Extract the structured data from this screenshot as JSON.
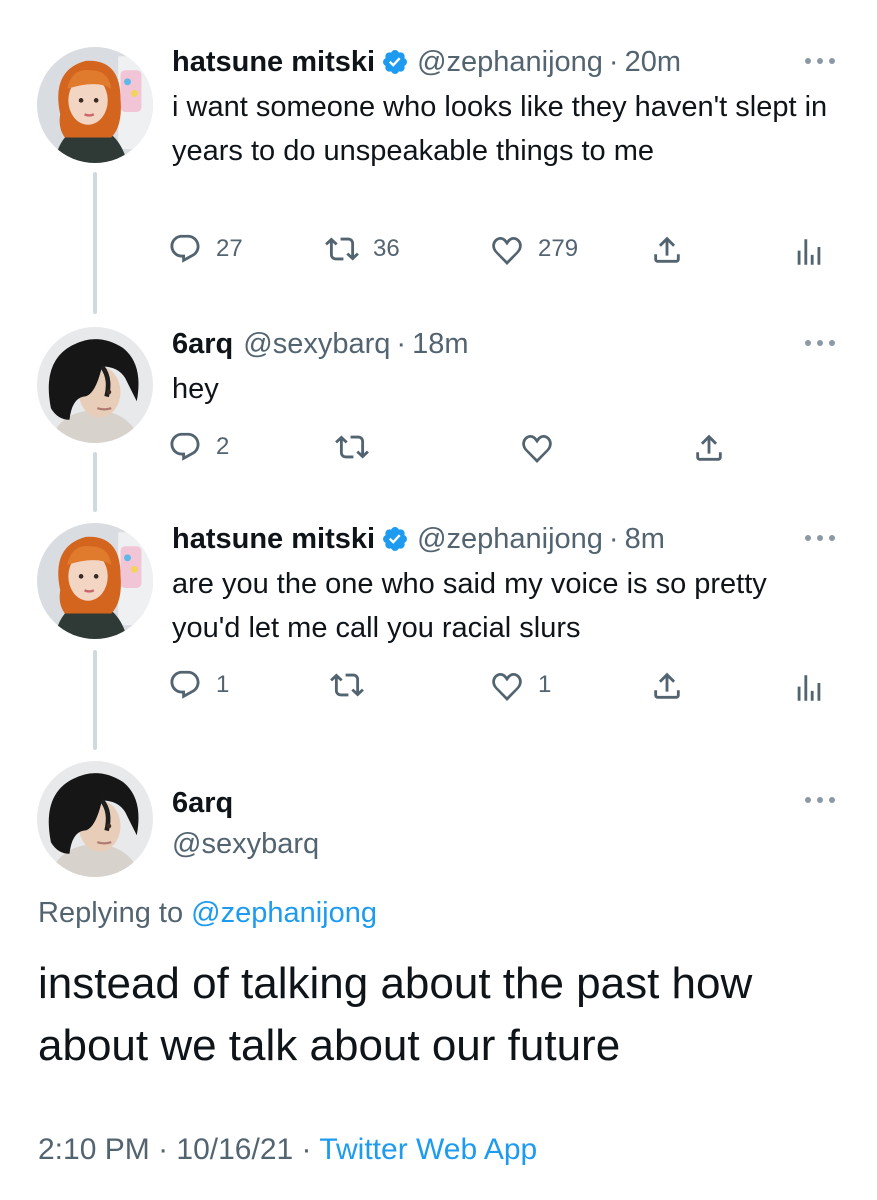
{
  "thread": [
    {
      "name": "hatsune mitski",
      "handle": "@zephanijong",
      "separator": "·",
      "time": "20m",
      "text": "i want someone who looks like they haven't slept in years to do unspeakable things to me",
      "verified": true,
      "avatar": "avatar-orange-hair",
      "replies": "27",
      "retweets": "36",
      "likes": "279"
    },
    {
      "name": "6arq",
      "handle": "@sexybarq",
      "separator": "·",
      "time": "18m",
      "text": "hey",
      "verified": false,
      "avatar": "avatar-dark-hair",
      "replies": "2",
      "retweets": "",
      "likes": ""
    },
    {
      "name": "hatsune mitski",
      "handle": "@zephanijong",
      "separator": "·",
      "time": "8m",
      "text": "are you the one who said my voice is so pretty you'd let me call you racial slurs",
      "verified": true,
      "avatar": "avatar-orange-hair",
      "replies": "1",
      "retweets": "",
      "likes": "1"
    }
  ],
  "main": {
    "name": "6arq",
    "handle": "@sexybarq",
    "replying_prefix": "Replying to",
    "replying_to": "@zephanijong",
    "text": "instead of talking about the past how about we talk about our future",
    "time": "2:10 PM",
    "date": "10/16/21",
    "separator": "·",
    "source": "Twitter Web App"
  },
  "colors": {
    "text": "#0f1419",
    "secondary": "#536471",
    "link": "#1d9bf0",
    "thread_line": "#cfd9de",
    "verified": "#1d9bf0"
  },
  "icons": [
    "reply-icon",
    "retweet-icon",
    "like-icon",
    "share-icon",
    "analytics-icon",
    "more-icon",
    "verified-badge-icon"
  ]
}
